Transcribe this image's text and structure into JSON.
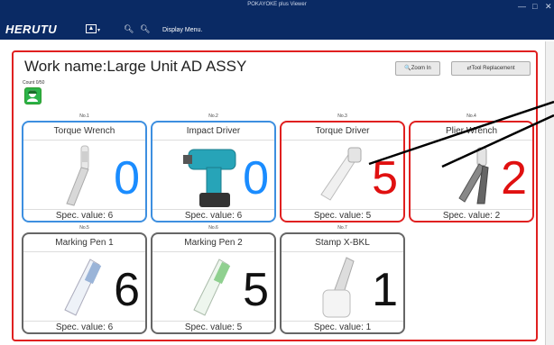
{
  "window": {
    "title": "POKAYOKE plus Viewer",
    "logo": "HERUTU",
    "controls": [
      "—",
      "□",
      "✕"
    ]
  },
  "toolbar": {
    "upload_glyph": "▲",
    "caret_glyph": "▾",
    "zoom_in_glyph": "🔍︎",
    "zoom_out_glyph": "🔍︎",
    "menu": "Display Menu."
  },
  "work": {
    "title": "Work name:Large Unit AD ASSY",
    "count": "Count 0/50",
    "zoom_in_button": "🔍Zoom In",
    "tool_replacement_button": "⇄Tool Replacement"
  },
  "tools": [
    {
      "no": "No.1",
      "name": "Torque Wrench",
      "count": "0",
      "spec": "Spec. value: 6",
      "status": "blue"
    },
    {
      "no": "No.2",
      "name": "Impact Driver",
      "count": "0",
      "spec": "Spec. value: 6",
      "status": "blue"
    },
    {
      "no": "No.3",
      "name": "Torque Driver",
      "count": "5",
      "spec": "Spec. value: 5",
      "status": "red"
    },
    {
      "no": "No.4",
      "name": "Plier Wrench",
      "count": "2",
      "spec": "Spec. value: 2",
      "status": "red"
    },
    {
      "no": "No.5",
      "name": "Marking Pen 1",
      "count": "6",
      "spec": "Spec. value: 6",
      "status": "gray"
    },
    {
      "no": "No.6",
      "name": "Marking Pen 2",
      "count": "5",
      "spec": "Spec. value: 5",
      "status": "gray"
    },
    {
      "no": "No.7",
      "name": "Stamp X-BKL",
      "count": "1",
      "spec": "Spec. value: 1",
      "status": "gray"
    }
  ],
  "colors": {
    "titlebar": "#0a2a64",
    "frame_red": "#e02020",
    "count_blue": "#1a8cff",
    "count_red": "#e01010",
    "status_green": "#2cb34a"
  }
}
